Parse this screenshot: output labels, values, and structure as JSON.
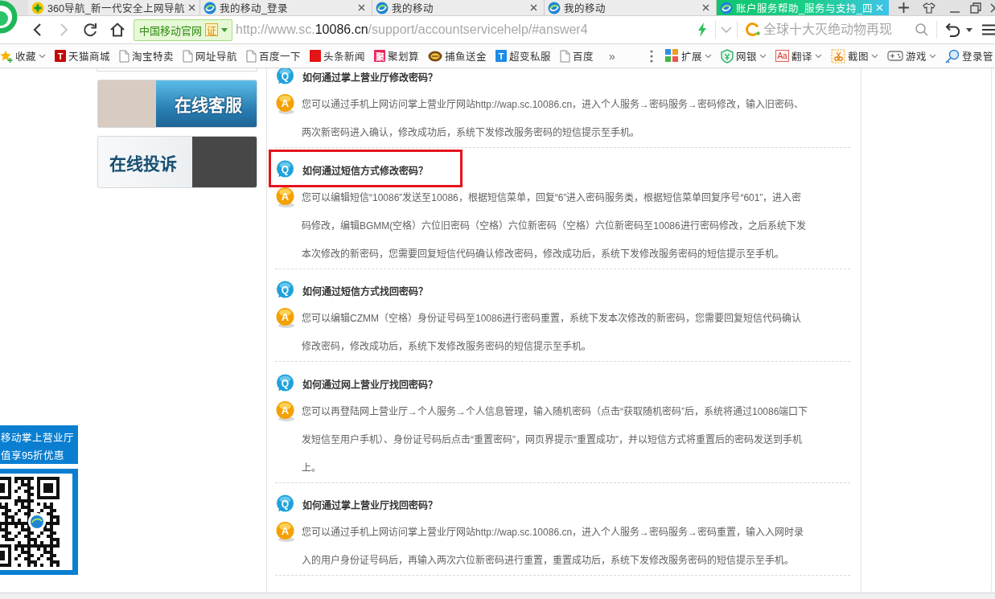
{
  "tabs": [
    {
      "kind": "portal",
      "title": "360导航_新一代安全上网导航",
      "selected": false
    },
    {
      "kind": "site",
      "title": "我的移动_登录",
      "selected": false
    },
    {
      "kind": "site",
      "title": "我的移动",
      "selected": false
    },
    {
      "kind": "site",
      "title": "我的移动",
      "selected": false
    },
    {
      "kind": "site",
      "title": "账户服务帮助_服务与支持_四",
      "selected": true
    }
  ],
  "address_bar": {
    "nav": [
      {
        "kind": "back",
        "disabled": false
      },
      {
        "kind": "forward",
        "disabled": true
      },
      {
        "kind": "reload",
        "disabled": false
      },
      {
        "kind": "home",
        "disabled": false
      }
    ],
    "site_badge": {
      "label": "中国移动官网",
      "cert": "证"
    },
    "url": "http://www.sc.**10086.cn**/support/accountservicehelp/#answer4",
    "search": {
      "placeholder": "全球十大灭绝动物再现"
    }
  },
  "bookmarks": [
    {
      "kind": "star",
      "label": "收藏",
      "menu": true
    },
    {
      "kind": "tile",
      "glyph": "T",
      "color": "#c40808",
      "label": "天猫商城",
      "menu": false
    },
    {
      "kind": "page",
      "label": "淘宝特卖",
      "menu": false
    },
    {
      "kind": "page",
      "label": "网址导航",
      "menu": false
    },
    {
      "kind": "page",
      "label": "百度一下",
      "menu": false
    },
    {
      "kind": "tile",
      "color": "#e41414",
      "label": "头条新闻",
      "menu": false
    },
    {
      "kind": "tile",
      "glyph": "聚",
      "color": "#e8245a",
      "label": "聚划算",
      "menu": false
    },
    {
      "kind": "coin",
      "label": "捕鱼送金",
      "menu": false
    },
    {
      "kind": "tile",
      "glyph": "T",
      "color": "#1e8be8",
      "label": "超变私服",
      "menu": false
    },
    {
      "kind": "page",
      "label": "百度",
      "menu": false
    }
  ],
  "bookmarks_more": "»",
  "toolbar_items": [
    {
      "kind": "grid",
      "label": "扩展",
      "menu": true
    },
    {
      "kind": "shield",
      "label": "网银",
      "menu": true
    },
    {
      "kind": "tile",
      "glyph": "Aa",
      "label": "翻译",
      "menu": true
    },
    {
      "kind": "crop",
      "label": "截图",
      "menu": true
    },
    {
      "kind": "gamepad",
      "label": "游戏",
      "menu": true
    },
    {
      "kind": "key",
      "label": "登录管",
      "menu": false
    }
  ],
  "sidebar": {
    "banners": [
      {
        "kind": "chat",
        "label": "在线客服"
      },
      {
        "kind": "complaint",
        "label": "在线投诉"
      }
    ],
    "promo_lines": [
      "移动掌上营业厅",
      "值享95折优惠"
    ]
  },
  "faq": [
    {
      "q_mark": "Q",
      "question": "如何通过掌上营业厅修改密码？",
      "a_mark": "A",
      "answer": "您可以通过手机上网访问掌上营业厅网站http://wap.sc.10086.cn，进入个人服务→密码服务→密码修改，输入旧密码、两次新密码进入确认，修改成功后，系统下发修改服务密码的短信提示至手机。",
      "highlighted": false
    },
    {
      "q_mark": "Q",
      "question": "如何通过短信方式修改密码？",
      "a_mark": "A",
      "answer": "您可以编辑短信“10086”发送至10086，根据短信菜单，回复“6”进入密码服务类，根据短信菜单回复序号“601”，进入密码修改，编辑BGMM(空格）六位旧密码（空格）六位新密码（空格）六位新密码至10086进行密码修改，之后系统下发本次修改的新密码，您需要回复短信代码确认修改密码，修改成功后，系统下发修改服务密码的短信提示至手机。",
      "highlighted": true
    },
    {
      "q_mark": "Q",
      "question": "如何通过短信方式找回密码？",
      "a_mark": "A",
      "answer": "您可以编辑CZMM（空格）身份证号码至10086进行密码重置，系统下发本次修改的新密码，您需要回复短信代码确认修改密码，修改成功后，系统下发修改服务密码的短信提示至手机。",
      "highlighted": false
    },
    {
      "q_mark": "Q",
      "question": "如何通过网上营业厅找回密码？",
      "a_mark": "A",
      "answer": "您可以再登陆网上营业厅→个人服务→个人信息管理，输入随机密码（点击“获取随机密码”后，系统将通过10086端口下发短信至用户手机）、身份证号码后点击“重置密码”，网页界提示“重置成功”，并以短信方式将重置后的密码发送到手机上。",
      "highlighted": false
    },
    {
      "q_mark": "Q",
      "question": "如何通过掌上营业厅找回密码？",
      "a_mark": "A",
      "answer": "您可以通过手机上网访问掌上营业厅网站http://wap.sc.10086.cn，进入个人服务→密码服务→密码重置，输入入网时录入的用户身份证号码后，再输入两次六位新密码进行重置，重置成功后，系统下发修改服务密码的短信提示至手机。",
      "highlighted": false
    }
  ]
}
